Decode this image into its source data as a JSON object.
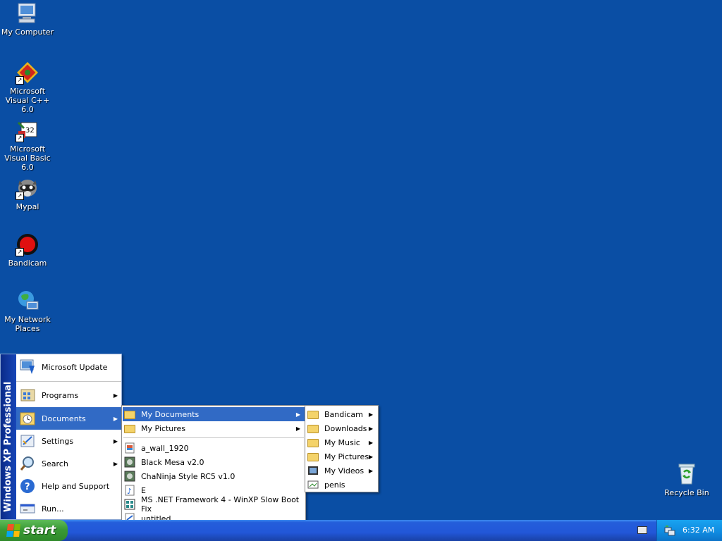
{
  "desktop": {
    "icons": [
      {
        "label": "My Computer",
        "icon": "my-computer-icon"
      },
      {
        "label": "Microsoft Visual C++ 6.0",
        "icon": "visual-cpp-icon"
      },
      {
        "label": "Microsoft Visual Basic 6.0",
        "icon": "visual-basic-icon"
      },
      {
        "label": "Mypal",
        "icon": "mypal-icon"
      },
      {
        "label": "Bandicam",
        "icon": "bandicam-icon"
      },
      {
        "label": "My Network Places",
        "icon": "network-places-icon"
      },
      {
        "label": "Recycle Bin",
        "icon": "recycle-bin-icon"
      }
    ]
  },
  "start_menu": {
    "banner": "Windows XP Professional",
    "items": [
      {
        "label": "Microsoft Update",
        "icon": "microsoft-update-icon",
        "submenu": false
      },
      {
        "label": "Programs",
        "icon": "programs-icon",
        "submenu": true
      },
      {
        "label": "Documents",
        "icon": "documents-icon",
        "submenu": true
      },
      {
        "label": "Settings",
        "icon": "settings-icon",
        "submenu": true
      },
      {
        "label": "Search",
        "icon": "search-icon",
        "submenu": true
      },
      {
        "label": "Help and Support",
        "icon": "help-icon",
        "submenu": false
      },
      {
        "label": "Run...",
        "icon": "run-icon",
        "submenu": false
      }
    ]
  },
  "documents_menu": {
    "folders": [
      {
        "label": "My Documents",
        "icon": "my-documents-icon"
      },
      {
        "label": "My Pictures",
        "icon": "my-pictures-icon"
      }
    ],
    "recent": [
      {
        "label": "a_wall_1920",
        "icon": "image-file-icon"
      },
      {
        "label": "Black Mesa v2.0",
        "icon": "app-file-icon"
      },
      {
        "label": "ChaNinja Style RC5 v1.0",
        "icon": "app-file-icon"
      },
      {
        "label": "E",
        "icon": "music-file-icon"
      },
      {
        "label": "MS .NET Framework 4 - WinXP Slow Boot Fix",
        "icon": "registry-file-icon"
      },
      {
        "label": "untitled",
        "icon": "text-file-icon"
      }
    ]
  },
  "my_documents_menu": {
    "items": [
      {
        "label": "Bandicam",
        "icon": "folder-icon",
        "submenu": true
      },
      {
        "label": "Downloads",
        "icon": "folder-icon",
        "submenu": true
      },
      {
        "label": "My Music",
        "icon": "my-music-icon",
        "submenu": true
      },
      {
        "label": "My Pictures",
        "icon": "my-pictures-icon",
        "submenu": true
      },
      {
        "label": "My Videos",
        "icon": "my-videos-icon",
        "submenu": true
      },
      {
        "label": "penis",
        "icon": "image-file-icon",
        "submenu": false
      }
    ]
  },
  "taskbar": {
    "start_label": "start",
    "clock": "6:32 AM",
    "tray_icons": [
      "keyboard-icon",
      "network-tray-icon"
    ]
  },
  "colors": {
    "desktop": "#0a4ea4",
    "highlight": "#316ac5"
  }
}
